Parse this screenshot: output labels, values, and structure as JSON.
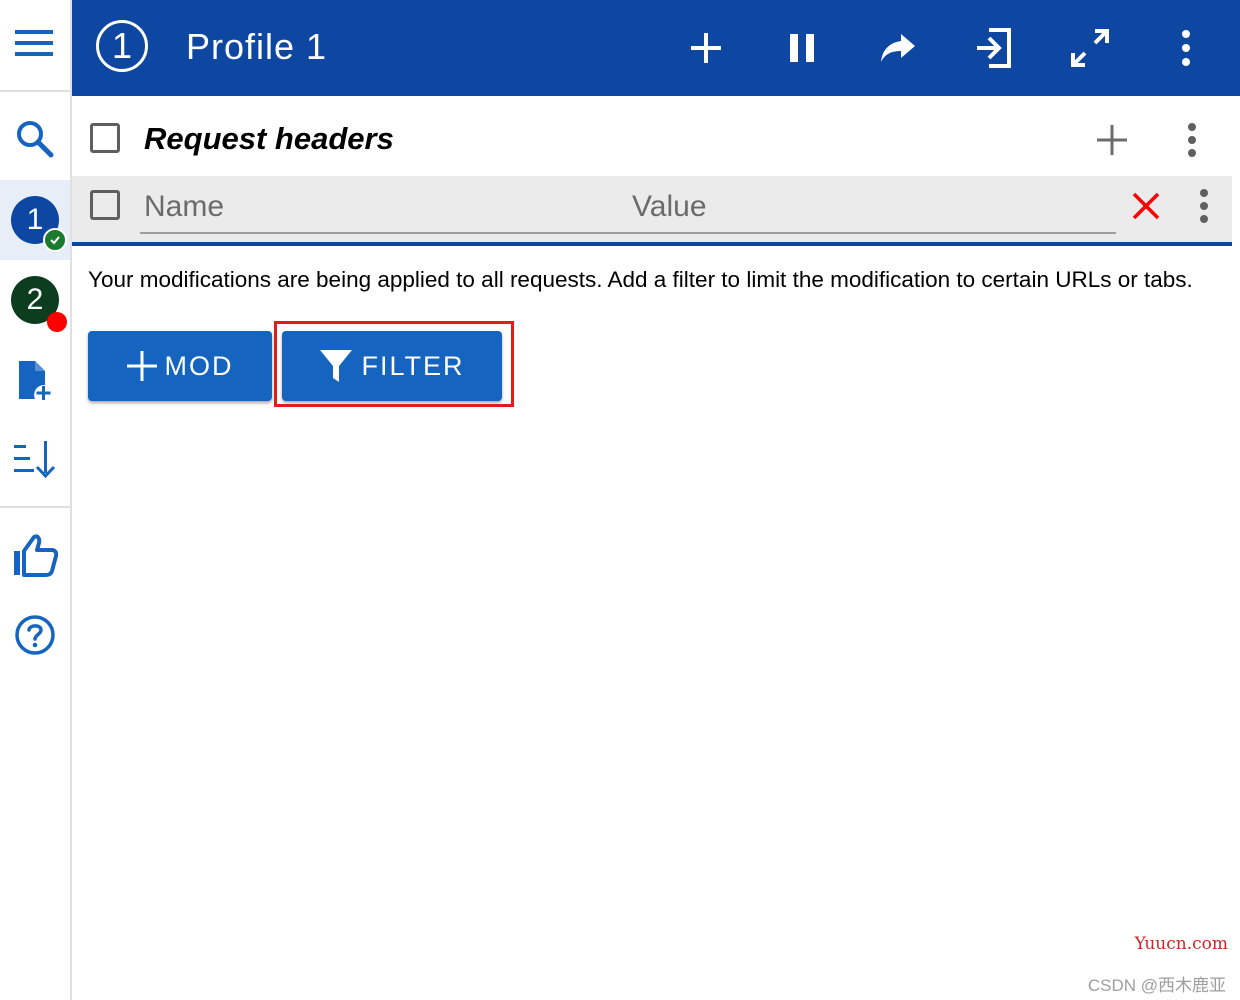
{
  "topbar": {
    "profile_number": "1",
    "title": "Profile 1",
    "bg_color": "#0d47a1"
  },
  "sidebar": {
    "profiles": [
      {
        "number": "1",
        "color": "#0d47a1",
        "status": "active",
        "badge_color": "#1b7a2c"
      },
      {
        "number": "2",
        "color": "#0b3d1e",
        "status": "paused",
        "badge_color": "#ff0000"
      }
    ]
  },
  "section": {
    "title": "Request headers"
  },
  "header_row": {
    "name_placeholder": "Name",
    "value_placeholder": "Value"
  },
  "message": "Your modifications are being applied to all requests. Add a filter to limit the modification to certain URLs or tabs.",
  "buttons": {
    "mod_label": "MOD",
    "filter_label": "FILTER",
    "color": "#1565c0"
  },
  "watermarks": {
    "site": "Yuucn.com",
    "author": "CSDN @西木鹿亚"
  }
}
